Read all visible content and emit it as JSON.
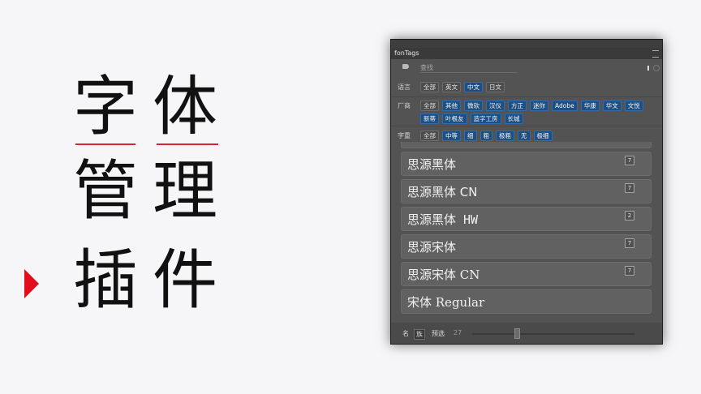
{
  "headline": {
    "row1": [
      "字",
      "体"
    ],
    "row2": [
      "管",
      "理"
    ],
    "row3": [
      "插",
      "件"
    ]
  },
  "colors": {
    "accent": "#e10d1d",
    "chip_active": "#1d4f82",
    "panel_bg": "#535353"
  },
  "panel": {
    "tab_title": "fonTags",
    "search": {
      "placeholder": "查找"
    },
    "filters": {
      "language": {
        "label": "语言",
        "options": [
          {
            "text": "全部",
            "active": false
          },
          {
            "text": "英文",
            "active": false
          },
          {
            "text": "中文",
            "active": true
          },
          {
            "text": "日文",
            "active": false
          }
        ]
      },
      "vendor": {
        "label": "厂商",
        "options": [
          {
            "text": "全部",
            "active": false
          },
          {
            "text": "其他",
            "active": true
          },
          {
            "text": "微软",
            "active": true
          },
          {
            "text": "汉仪",
            "active": true
          },
          {
            "text": "方正",
            "active": true
          },
          {
            "text": "迷你",
            "active": true
          },
          {
            "text": "Adobe",
            "active": true
          },
          {
            "text": "华康",
            "active": true
          },
          {
            "text": "华文",
            "active": true
          },
          {
            "text": "文悦",
            "active": true
          },
          {
            "text": "新蒂",
            "active": true
          },
          {
            "text": "叶根友",
            "active": true
          },
          {
            "text": "造字工房",
            "active": true
          },
          {
            "text": "长城",
            "active": true
          }
        ]
      },
      "weight": {
        "label": "字重",
        "options": [
          {
            "text": "全部",
            "active": false
          },
          {
            "text": "中等",
            "active": true
          },
          {
            "text": "细",
            "active": true
          },
          {
            "text": "粗",
            "active": true
          },
          {
            "text": "极粗",
            "active": true
          },
          {
            "text": "无",
            "active": true
          },
          {
            "text": "极细",
            "active": true
          }
        ]
      }
    },
    "fonts": [
      {
        "name": "思源黑体",
        "count": "7",
        "style": "sans"
      },
      {
        "name": "思源黑体 CN",
        "count": "7",
        "style": "sans"
      },
      {
        "name": "思源黑体 HW",
        "count": "2",
        "style": "mono"
      },
      {
        "name": "思源宋体",
        "count": "7",
        "style": "serif"
      },
      {
        "name": "思源宋体 CN",
        "count": "7",
        "style": "serif"
      },
      {
        "name": "宋体 Regular",
        "count": "",
        "style": "serif"
      }
    ],
    "bottom": {
      "btn_name": "名",
      "btn_family": "族",
      "btn_preview": "预选",
      "size": "27"
    }
  }
}
